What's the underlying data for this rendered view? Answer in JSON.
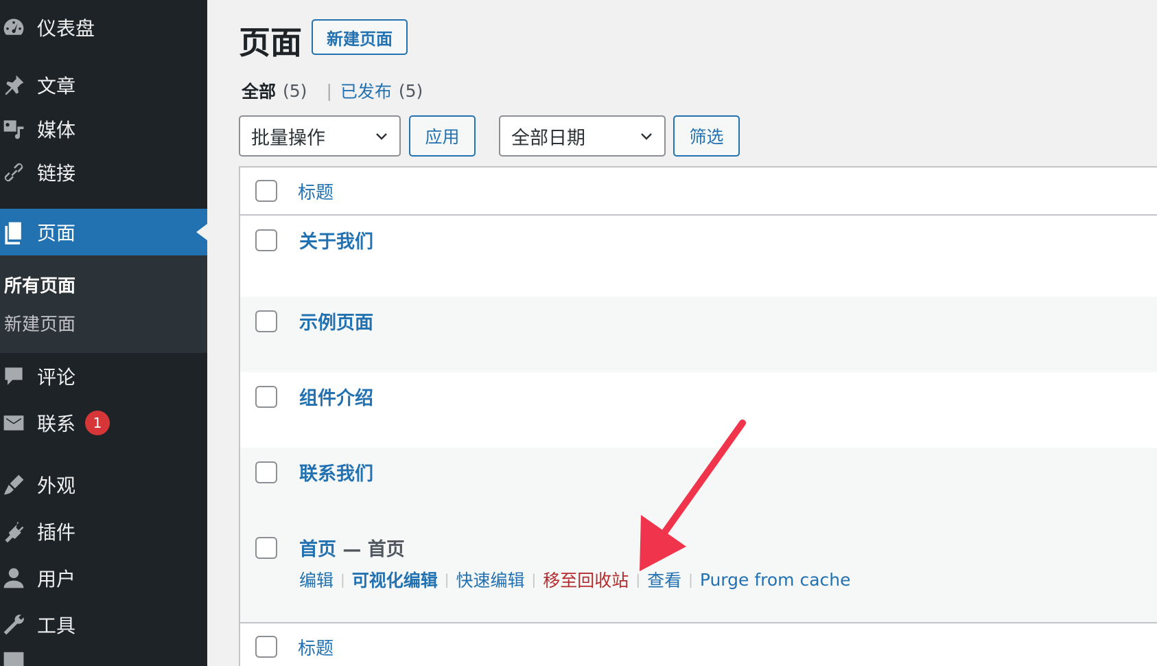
{
  "sidebar": {
    "items": [
      {
        "label": "仪表盘",
        "icon": "dashboard-icon"
      },
      {
        "label": "文章",
        "icon": "pin-icon"
      },
      {
        "label": "媒体",
        "icon": "media-icon"
      },
      {
        "label": "链接",
        "icon": "link-icon"
      },
      {
        "label": "页面",
        "icon": "page-icon"
      },
      {
        "label": "评论",
        "icon": "comment-icon"
      },
      {
        "label": "联系",
        "icon": "mail-icon",
        "badge": "1"
      },
      {
        "label": "外观",
        "icon": "brush-icon"
      },
      {
        "label": "插件",
        "icon": "plugin-icon"
      },
      {
        "label": "用户",
        "icon": "user-icon"
      },
      {
        "label": "工具",
        "icon": "wrench-icon"
      }
    ],
    "submenu": {
      "current": "所有页面",
      "other": "新建页面"
    }
  },
  "header": {
    "title": "页面",
    "add_new": "新建页面"
  },
  "views": {
    "all_label": "全部",
    "all_count": "(5)",
    "published_label": "已发布",
    "published_count": "(5)"
  },
  "toolbar": {
    "bulk_select": "批量操作",
    "apply": "应用",
    "date_select": "全部日期",
    "filter": "筛选"
  },
  "table": {
    "column_title": "标题",
    "rows": [
      {
        "title": "关于我们"
      },
      {
        "title": "示例页面"
      },
      {
        "title": "组件介绍"
      },
      {
        "title": "联系我们"
      },
      {
        "title": "首页",
        "state": " — 首页"
      }
    ],
    "row_actions": [
      "编辑",
      "可视化编辑",
      "快速编辑",
      "移至回收站",
      "查看",
      "Purge from cache"
    ]
  },
  "colors": {
    "accent": "#2271b1",
    "sidebar": "#1d2327",
    "annotation_arrow": "#f0344b",
    "trash": "#b32d2e"
  }
}
